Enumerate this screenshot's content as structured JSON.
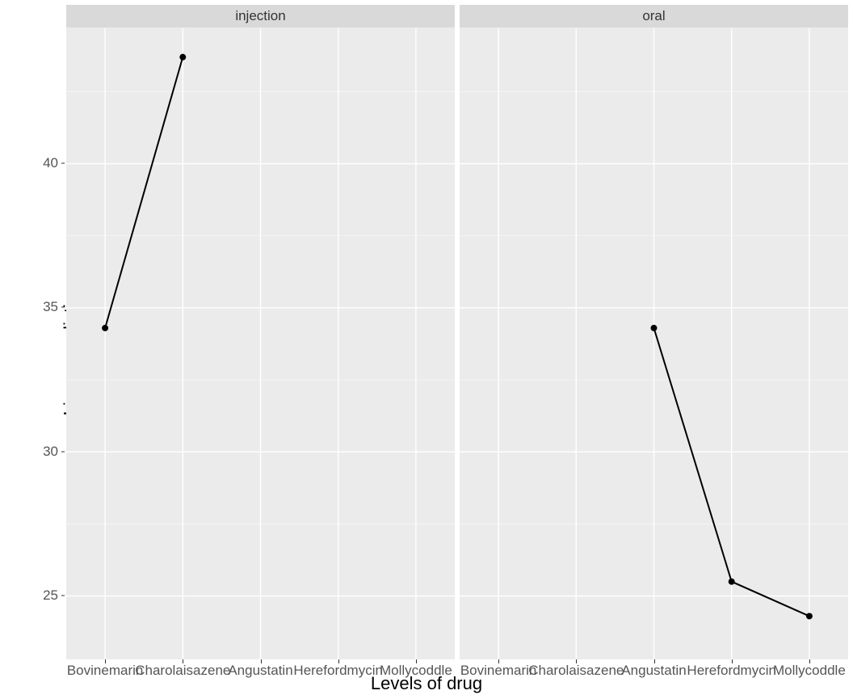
{
  "chart_data": {
    "type": "line",
    "facets": [
      "injection",
      "oral"
    ],
    "categories": [
      "Bovinemarin",
      "Charolaisazene",
      "Angustatin",
      "Herefordmycin",
      "Mollycoddle"
    ],
    "series": [
      {
        "name": "injection",
        "x": [
          "Bovinemarin",
          "Charolaisazene"
        ],
        "y": [
          34.3,
          43.7
        ]
      },
      {
        "name": "oral",
        "x": [
          "Angustatin",
          "Herefordmycin",
          "Mollycoddle"
        ],
        "y": [
          34.3,
          25.5,
          24.3
        ]
      }
    ],
    "ylim": [
      22.8,
      44.7
    ],
    "y_ticks": [
      25,
      30,
      35,
      40
    ],
    "xlabel": "Levels of drug",
    "ylabel": "Linear prediction",
    "title": "",
    "grid": true
  },
  "yTicks": {
    "t0": "25",
    "t1": "30",
    "t2": "35",
    "t3": "40"
  },
  "xCats": {
    "c0": "Bovinemarin",
    "c1": "Charolaisazene",
    "c2": "Angustatin",
    "c3": "Herefordmycin",
    "c4": "Mollycoddle"
  },
  "strips": {
    "s0": "injection",
    "s1": "oral"
  },
  "axes": {
    "x": "Levels of drug",
    "y": "Linear prediction"
  }
}
